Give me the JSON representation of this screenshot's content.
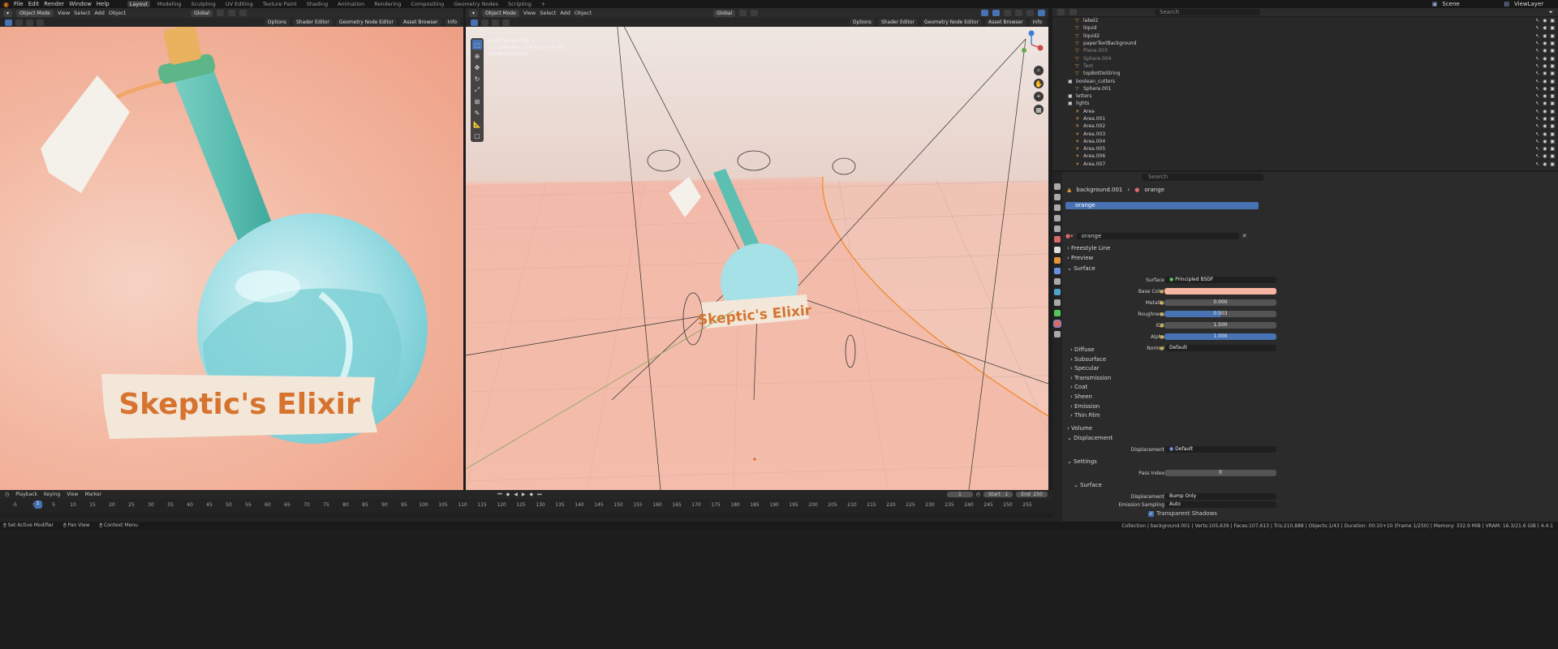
{
  "topbar": {
    "menus": [
      "File",
      "Edit",
      "Render",
      "Window",
      "Help"
    ],
    "workspaces": [
      "Layout",
      "Modeling",
      "Sculpting",
      "UV Editing",
      "Texture Paint",
      "Shading",
      "Animation",
      "Rendering",
      "Compositing",
      "Geometry Nodes",
      "Scripting"
    ],
    "active_workspace": "Layout",
    "scene": "Scene",
    "view_layer": "ViewLayer"
  },
  "left_view": {
    "mode": "Object Mode",
    "menus": [
      "View",
      "Select",
      "Add",
      "Object"
    ],
    "orientation": "Global",
    "options": "Options",
    "editor_tabs": [
      "Shader Editor",
      "Geometry Node Editor",
      "Asset Browser",
      "Info"
    ],
    "label_text": "Skeptic's Elixir"
  },
  "right_view": {
    "mode": "Object Mode",
    "menus": [
      "View",
      "Select",
      "Add",
      "Object"
    ],
    "orientation": "Global",
    "options": "Options",
    "editor_tabs": [
      "Shader Editor",
      "Geometry Node Editor",
      "Asset Browser",
      "Info"
    ],
    "info_lines": [
      "User Perspective",
      "(1) Collection | background.001",
      "Rendering Done"
    ],
    "label_text": "Skeptic's Elixir"
  },
  "outliner": {
    "search_placeholder": "Search",
    "rows": [
      {
        "name": "label2",
        "indent": 2,
        "kind": "object"
      },
      {
        "name": "liquid",
        "indent": 2,
        "kind": "object"
      },
      {
        "name": "liquid2",
        "indent": 2,
        "kind": "object"
      },
      {
        "name": "paperTextBackground",
        "indent": 2,
        "kind": "object"
      },
      {
        "name": "Plane.003",
        "indent": 2,
        "kind": "object",
        "dim": true
      },
      {
        "name": "Sphere.004",
        "indent": 2,
        "kind": "object",
        "dim": true
      },
      {
        "name": "Text",
        "indent": 2,
        "kind": "object",
        "dim": true
      },
      {
        "name": "topBottleString",
        "indent": 2,
        "kind": "object"
      },
      {
        "name": "boolean_cutters",
        "indent": 1,
        "kind": "collection"
      },
      {
        "name": "Sphere.001",
        "indent": 2,
        "kind": "object"
      },
      {
        "name": "letters",
        "indent": 1,
        "kind": "collection"
      },
      {
        "name": "lights",
        "indent": 1,
        "kind": "collection"
      },
      {
        "name": "Area",
        "indent": 2,
        "kind": "light"
      },
      {
        "name": "Area.001",
        "indent": 2,
        "kind": "light"
      },
      {
        "name": "Area.002",
        "indent": 2,
        "kind": "light"
      },
      {
        "name": "Area.003",
        "indent": 2,
        "kind": "light"
      },
      {
        "name": "Area.004",
        "indent": 2,
        "kind": "light"
      },
      {
        "name": "Area.005",
        "indent": 2,
        "kind": "light"
      },
      {
        "name": "Area.006",
        "indent": 2,
        "kind": "light"
      },
      {
        "name": "Area.007",
        "indent": 2,
        "kind": "light"
      }
    ]
  },
  "properties": {
    "search_placeholder": "Search",
    "breadcrumb_object": "background.001",
    "breadcrumb_material": "orange",
    "slot_name": "orange",
    "material_name": "orange",
    "panels": {
      "freestyle": "Freestyle Line",
      "preview": "Preview",
      "surface": "Surface",
      "volume": "Volume",
      "displacement": "Displacement",
      "settings": "Settings",
      "settings_surface": "Surface"
    },
    "surface_shader_label": "Surface",
    "surface_shader": "Principled BSDF",
    "fields": [
      {
        "label": "Base Color",
        "value": "",
        "type": "color",
        "color": "#f7b6a3"
      },
      {
        "label": "Metallic",
        "value": "0.000",
        "type": "num"
      },
      {
        "label": "Roughness",
        "value": "0.503",
        "type": "num",
        "fill": 0.503
      },
      {
        "label": "IOR",
        "value": "1.500",
        "type": "num"
      },
      {
        "label": "Alpha",
        "value": "1.000",
        "type": "num",
        "fill": 1.0
      },
      {
        "label": "Normal",
        "value": "Default",
        "type": "link"
      }
    ],
    "subpanels": [
      "Diffuse",
      "Subsurface",
      "Specular",
      "Transmission",
      "Coat",
      "Sheen",
      "Emission",
      "Thin Film"
    ],
    "displacement_label": "Displacement",
    "displacement_value": "Default",
    "pass_index_label": "Pass Index",
    "pass_index": "0",
    "settings_displacement_label": "Displacement",
    "settings_displacement_value": "Bump Only",
    "emission_sampling_label": "Emission Sampling",
    "emission_sampling_value": "Auto",
    "transparent_shadows": "Transparent Shadows"
  },
  "timeline": {
    "menus": [
      "Playback",
      "Keying",
      "View",
      "Marker"
    ],
    "current_frame": "1",
    "start_label": "Start",
    "start": "1",
    "end_label": "End",
    "end": "250",
    "ticks": [
      "-5",
      "0",
      "5",
      "10",
      "15",
      "20",
      "25",
      "30",
      "35",
      "40",
      "45",
      "50",
      "55",
      "60",
      "65",
      "70",
      "75",
      "80",
      "85",
      "90",
      "95",
      "100",
      "105",
      "110",
      "115",
      "120",
      "125",
      "130",
      "135",
      "140",
      "145",
      "150",
      "155",
      "160",
      "165",
      "170",
      "175",
      "180",
      "185",
      "190",
      "195",
      "200",
      "205",
      "210",
      "215",
      "220",
      "225",
      "230",
      "235",
      "240",
      "245",
      "250",
      "255"
    ]
  },
  "status": {
    "left": [
      "Set Active Modifier",
      "Pan View",
      "Context Menu"
    ],
    "right": "Collection | background.001 | Verts:105,639 | Faces:107,613 | Tris:210,888 | Objects:1/43 | Duration: 00:10+10 (Frame 1/250) | Memory: 332.9 MiB | VRAM: 16.3/21.6 GiB | 4.4.1"
  },
  "colors": {
    "accent": "#4772b3",
    "outliner_object": "#e2943d",
    "mesh_data": "#54c85a",
    "light": "#e2943d",
    "bottle": "#58bdb1"
  }
}
